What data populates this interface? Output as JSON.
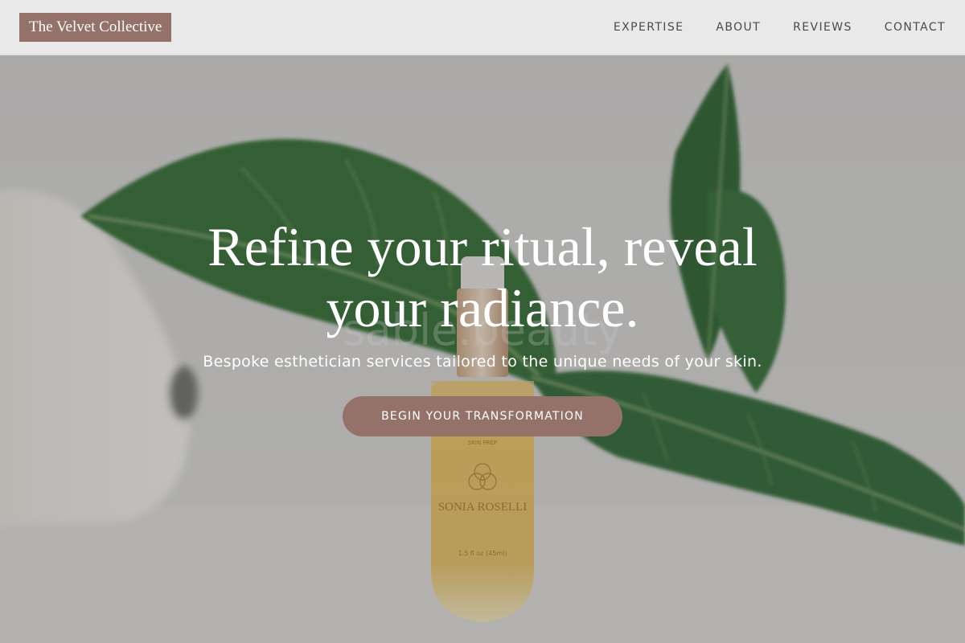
{
  "brand": {
    "name": "The Velvet Collective",
    "color": "#94726a"
  },
  "nav": {
    "items": [
      {
        "label": "EXPERTISE"
      },
      {
        "label": "ABOUT"
      },
      {
        "label": "REVIEWS"
      },
      {
        "label": "CONTACT"
      }
    ]
  },
  "hero": {
    "headline_line1": "Refine your ritual, reveal",
    "headline_line2": "your radiance.",
    "subheadline": "Bespoke esthetician services tailored to the unique needs of your skin.",
    "cta_label": "BEGIN YOUR TRANSFORMATION",
    "image": {
      "watermark": "sable.beauty",
      "bottle_brand": "SONIA ROSELLI",
      "bottle_line": "SKIN PREP",
      "bottle_size": "1.5 fl oz (45ml)"
    }
  }
}
